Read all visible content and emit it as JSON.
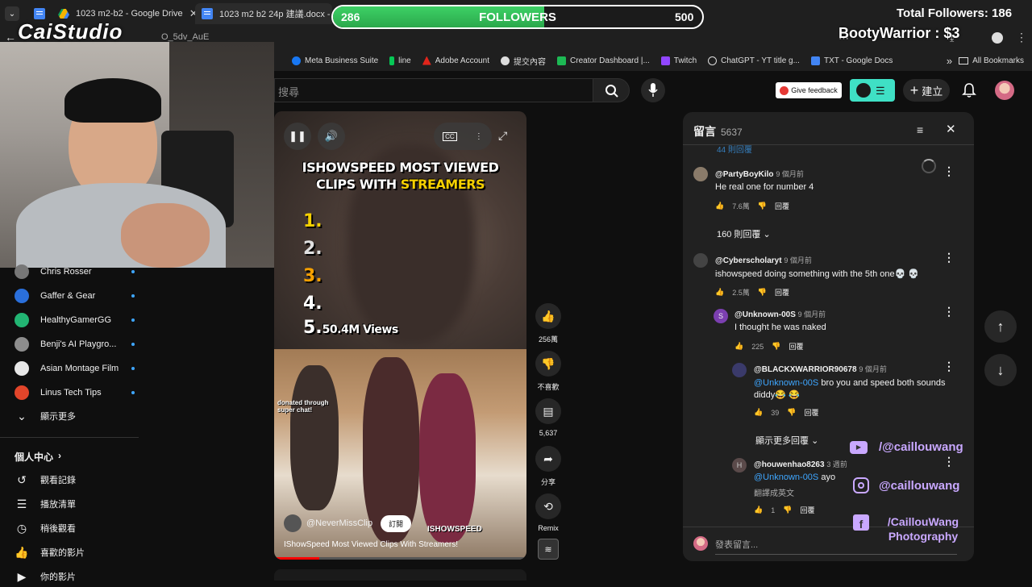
{
  "browser": {
    "tabs": [
      {
        "label": "1023 m2-b2 - Google Drive",
        "icon": "drive-icon"
      },
      {
        "label": "1023 m2 b2 24p 建議.docx - G",
        "icon": "docs-icon"
      }
    ],
    "url": "O_5dv_AuE",
    "bookmarks": [
      {
        "label": "Meta Business Suite",
        "color": "#1877f2"
      },
      {
        "label": "line",
        "color": "#06c755"
      },
      {
        "label": "Adobe Account",
        "color": "#e1251b"
      },
      {
        "label": "提交內容",
        "color": "#dddddd"
      },
      {
        "label": "Creator Dashboard |...",
        "color": "#1db954"
      },
      {
        "label": "Twitch",
        "color": "#9146ff"
      },
      {
        "label": "ChatGPT - YT title g...",
        "color": "#dddddd"
      },
      {
        "label": "TXT - Google Docs",
        "color": "#4285f4"
      }
    ],
    "more_label": "»",
    "all_bookmarks": "All Bookmarks"
  },
  "stream": {
    "logo": "CaiStudio",
    "followers_label": "FOLLOWERS",
    "followers_current": "286",
    "followers_goal": "500",
    "followers_progress": 0.572,
    "total_followers": "Total Followers: 186",
    "donation": "BootyWarrior : $3",
    "socials": [
      {
        "icon": "youtube-icon",
        "label": "/@caillouwang",
        "color": "#ff0000"
      },
      {
        "icon": "instagram-icon",
        "label": "@caillouwang",
        "color": "#ffffff"
      },
      {
        "icon": "facebook-icon",
        "label": "/CaillouWang Photography",
        "color": "#1877f2"
      }
    ]
  },
  "yt": {
    "search_placeholder": "搜尋",
    "feedback_label": "Give feedback",
    "create_label": "建立"
  },
  "sidebar": {
    "subscriptions": [
      {
        "label": "Chris Rosser",
        "color": "#777777"
      },
      {
        "label": "Gaffer & Gear",
        "color": "#2a6fdb"
      },
      {
        "label": "HealthyGamerGG",
        "color": "#22b573"
      },
      {
        "label": "Benji's AI Playgro...",
        "color": "#8d8d8d"
      },
      {
        "label": "Asian Montage Film",
        "color": "#e8e8e8"
      },
      {
        "label": "Linus Tech Tips",
        "color": "#e2452a"
      }
    ],
    "show_more": "顯示更多",
    "you_label": "個人中心",
    "you_items": [
      {
        "label": "觀看記錄",
        "icon": "history-icon",
        "glyph": "↺"
      },
      {
        "label": "播放清單",
        "icon": "playlist-icon",
        "glyph": "☰"
      },
      {
        "label": "稍後觀看",
        "icon": "clock-icon",
        "glyph": "◷"
      },
      {
        "label": "喜歡的影片",
        "icon": "thumb-up-icon",
        "glyph": "👍"
      },
      {
        "label": "你的影片",
        "icon": "your-videos-icon",
        "glyph": "▶"
      }
    ]
  },
  "video": {
    "headline_1": "ISHOWSPEED MOST VIEWED",
    "headline_2a": "CLIPS WITH ",
    "headline_2b": "STREAMERS",
    "ranks": [
      "1.",
      "2.",
      "3.",
      "4.",
      "5."
    ],
    "views": "50.4M Views",
    "donation_overlay": "donated through super chat!",
    "watermark": "ISHOWSPEED",
    "channel": "@NeverMissClip",
    "subscribe_label": "訂閱",
    "title": "IShowSpeed Most Viewed Clips With Streamers!"
  },
  "actions": {
    "likes": "256萬",
    "dislike": "不喜歡",
    "comments": "5,637",
    "share": "分享",
    "remix": "Remix"
  },
  "comments_panel": {
    "title": "留言",
    "count": "5637",
    "partial_top": "44 則回覆",
    "items": [
      {
        "user": "@PartyBoyKilo",
        "time": "9 個月前",
        "text": "He real one for number 4",
        "likes": "7.6萬",
        "reply": "回覆",
        "replies": "160 則回覆"
      },
      {
        "user": "@Cyberscholaryt",
        "time": "9 個月前",
        "text": "ishowspeed doing something with the 5th one💀 💀",
        "likes": "2.5萬",
        "reply": "回覆"
      }
    ],
    "replies": [
      {
        "user": "@Unknown-00S",
        "time": "9 個月前",
        "text": "I thought he was naked",
        "likes": "225",
        "reply": "回覆",
        "avatar_letter": "S",
        "color": "#7b3fb0"
      },
      {
        "user": "@BLACKXWARRIOR90678",
        "time": "9 個月前",
        "mention": "@Unknown-00S",
        "text": " bro you and speed both sounds diddy😂 😂",
        "likes": "39",
        "reply": "回覆"
      },
      {
        "user": "@houwenhao8263",
        "time": "3 週前",
        "mention": "@Unknown-00S",
        "text": " ayo",
        "text2": "翻譯成英文",
        "likes": "1",
        "reply": "回覆",
        "avatar_letter": "H",
        "color": "#5a4a4a"
      }
    ],
    "show_more_replies": "顯示更多回覆",
    "add_comment": "發表留言..."
  }
}
